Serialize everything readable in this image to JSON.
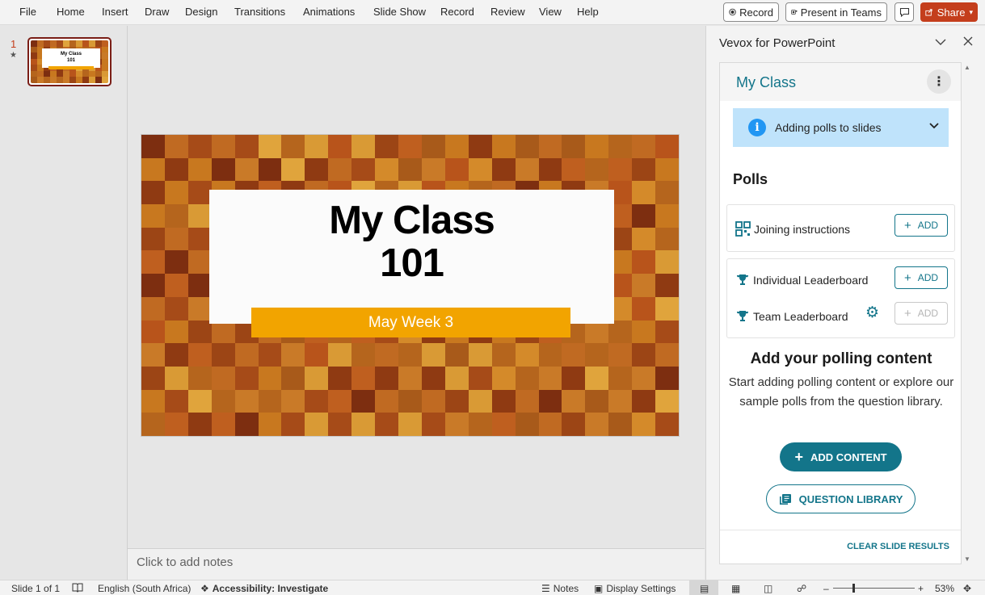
{
  "ribbon": {
    "menus": [
      "File",
      "Home",
      "Insert",
      "Draw",
      "Design",
      "Transitions",
      "Animations",
      "Slide Show",
      "Record",
      "Review",
      "View",
      "Help"
    ],
    "record_label": "Record",
    "present_teams_label": "Present in Teams",
    "share_label": "Share"
  },
  "thumbnails": [
    {
      "number": "1",
      "title": "My Class\n101",
      "subtitle": "May Week 3"
    }
  ],
  "slide": {
    "title": "My Class\n101",
    "subtitle": "May Week 3"
  },
  "notes": {
    "placeholder": "Click to add notes"
  },
  "taskpane": {
    "title": "Vevox for PowerPoint",
    "session_name": "My Class",
    "info_label": "Adding polls to slides",
    "polls_heading": "Polls",
    "joining_label": "Joining instructions",
    "individual_label": "Individual Leaderboard",
    "team_label": "Team Leaderboard",
    "add_label": "ADD",
    "empty_heading": "Add your polling content",
    "empty_text": "Start adding polling content or explore our sample polls from the question library.",
    "add_content_label": "ADD CONTENT",
    "question_library_label": "QUESTION LIBRARY",
    "clear_results_label": "CLEAR SLIDE RESULTS"
  },
  "statusbar": {
    "slide_info": "Slide 1 of 1",
    "language": "English (South Africa)",
    "accessibility": "Accessibility: Investigate",
    "notes_label": "Notes",
    "display_settings_label": "Display Settings",
    "zoom": "53%"
  },
  "colors": {
    "accent": "#13758a",
    "share": "#c43e1c",
    "subtitle_bar": "#f2a400"
  }
}
